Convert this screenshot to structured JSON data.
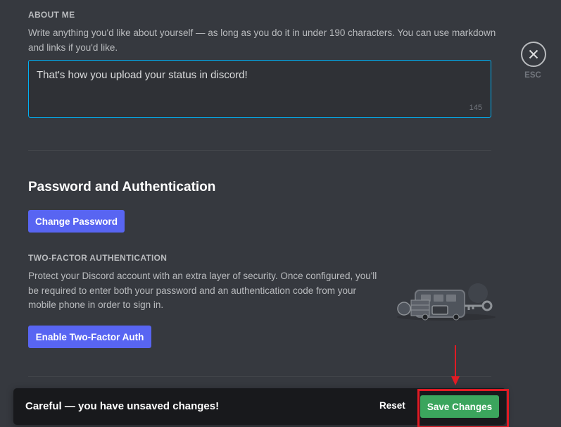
{
  "about": {
    "heading": "ABOUT ME",
    "description": "Write anything you'd like about yourself — as long as you do it in under 190 characters. You can use markdown and links if you'd like.",
    "bio_value": "That's how you upload your status in discord!",
    "char_count": "145"
  },
  "password_section": {
    "title": "Password and Authentication",
    "change_password_label": "Change Password"
  },
  "twofa": {
    "heading": "TWO-FACTOR AUTHENTICATION",
    "description": "Protect your Discord account with an extra layer of security. Once configured, you'll be required to enter both your password and an authentication code from your mobile phone in order to sign in.",
    "enable_label": "Enable Two-Factor Auth"
  },
  "close": {
    "icon": "close-icon",
    "label": "ESC"
  },
  "notice": {
    "message": "Careful — you have unsaved changes!",
    "reset_label": "Reset",
    "save_label": "Save Changes"
  },
  "colors": {
    "background": "#36393f",
    "blurple": "#5865f2",
    "save_green": "#3ba55d",
    "annotation_red": "#e01b24",
    "focus_blue": "#00b0f4"
  }
}
